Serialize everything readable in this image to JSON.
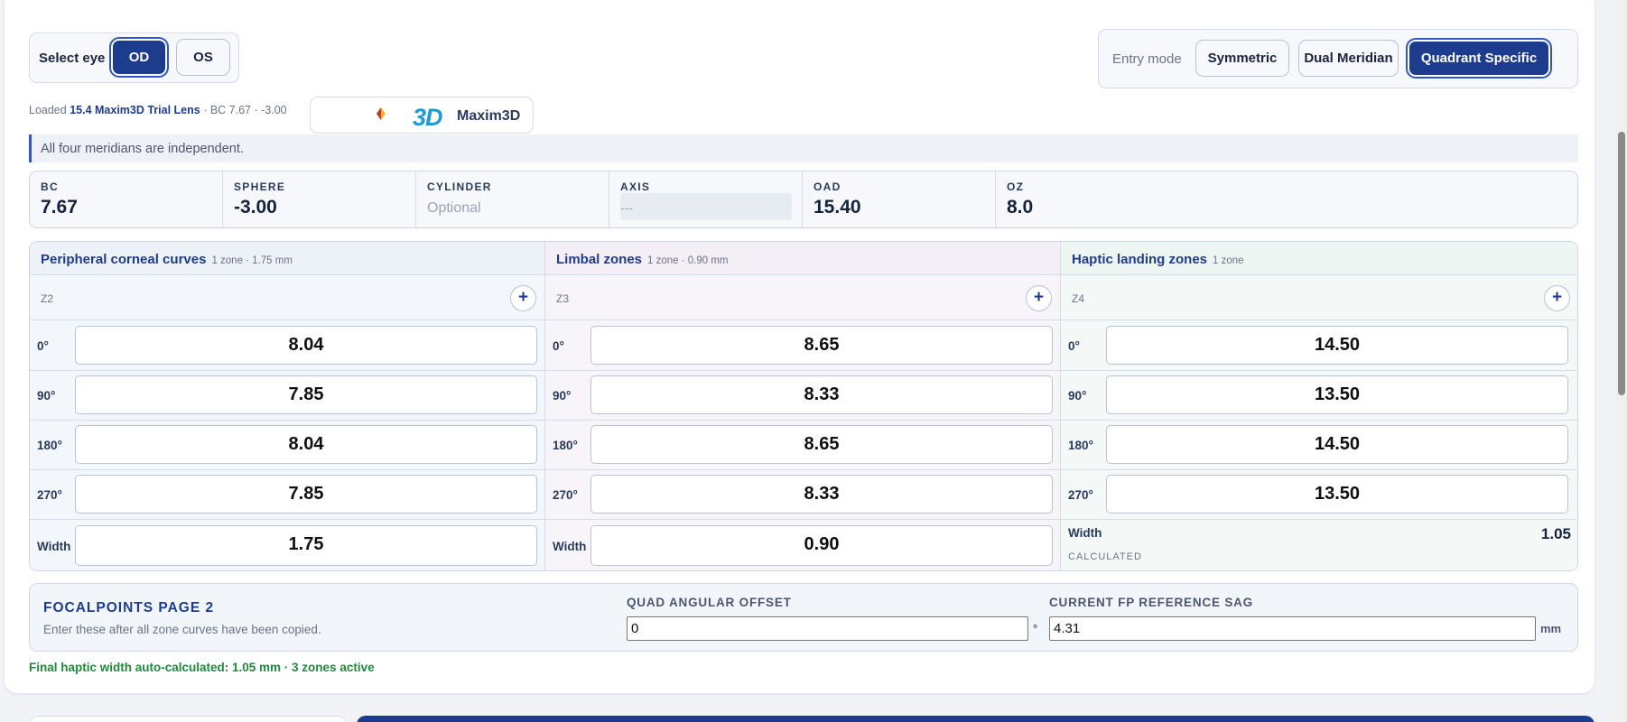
{
  "eye_selector": {
    "label": "Select eye",
    "options": [
      "OD",
      "OS"
    ],
    "selected": "OD"
  },
  "entry_mode": {
    "label": "Entry mode",
    "options": [
      "Symmetric",
      "Dual Meridian",
      "Quadrant Specific"
    ],
    "selected": "Quadrant Specific"
  },
  "loaded": {
    "prefix": "Loaded",
    "lens": "15.4 Maxim3D Trial Lens",
    "detail": "· BC 7.67 · -3.00"
  },
  "logo": {
    "mark": "3D",
    "name": "Maxim3D"
  },
  "info": "All four meridians are independent.",
  "params": {
    "bc": {
      "label": "BC",
      "value": "7.67"
    },
    "sphere": {
      "label": "SPHERE",
      "value": "-3.00"
    },
    "cylinder": {
      "label": "CYLINDER",
      "placeholder": "Optional"
    },
    "axis": {
      "label": "AXIS",
      "placeholder": "---"
    },
    "oad": {
      "label": "OAD",
      "value": "15.40"
    },
    "oz": {
      "label": "OZ",
      "value": "8.0"
    }
  },
  "zones": [
    {
      "title": "Peripheral corneal curves",
      "subtitle": "1 zone · 1.75 mm",
      "zone_label": "Z2",
      "rows": [
        {
          "deg": "0°",
          "value": "8.04"
        },
        {
          "deg": "90°",
          "value": "7.85"
        },
        {
          "deg": "180°",
          "value": "8.04"
        },
        {
          "deg": "270°",
          "value": "7.85"
        }
      ],
      "width_label": "Width",
      "width_value": "1.75"
    },
    {
      "title": "Limbal zones",
      "subtitle": "1 zone · 0.90 mm",
      "zone_label": "Z3",
      "rows": [
        {
          "deg": "0°",
          "value": "8.65"
        },
        {
          "deg": "90°",
          "value": "8.33"
        },
        {
          "deg": "180°",
          "value": "8.65"
        },
        {
          "deg": "270°",
          "value": "8.33"
        }
      ],
      "width_label": "Width",
      "width_value": "0.90"
    },
    {
      "title": "Haptic landing zones",
      "subtitle": "1 zone",
      "zone_label": "Z4",
      "rows": [
        {
          "deg": "0°",
          "value": "14.50"
        },
        {
          "deg": "90°",
          "value": "13.50"
        },
        {
          "deg": "180°",
          "value": "14.50"
        },
        {
          "deg": "270°",
          "value": "13.50"
        }
      ],
      "width_label": "Width",
      "width_value": "1.05",
      "width_note": "CALCULATED"
    }
  ],
  "add_zone_symbol": "+",
  "focalpoints": {
    "title": "FOCALPOINTS PAGE 2",
    "subtitle": "Enter these after all zone curves have been copied.",
    "quad_offset": {
      "label": "QUAD ANGULAR OFFSET",
      "value": "0",
      "unit": "°"
    },
    "fp_ref_sag": {
      "label": "CURRENT FP REFERENCE SAG",
      "value": "4.31",
      "unit": "mm"
    }
  },
  "footer_note": "Final haptic width auto-calculated: 1.05 mm · 3 zones active",
  "colors": {
    "primary": "#1e3c8e",
    "accent": "#2f55c9",
    "success": "#1f8a3c",
    "logo_blue": "#1e9bd7"
  }
}
